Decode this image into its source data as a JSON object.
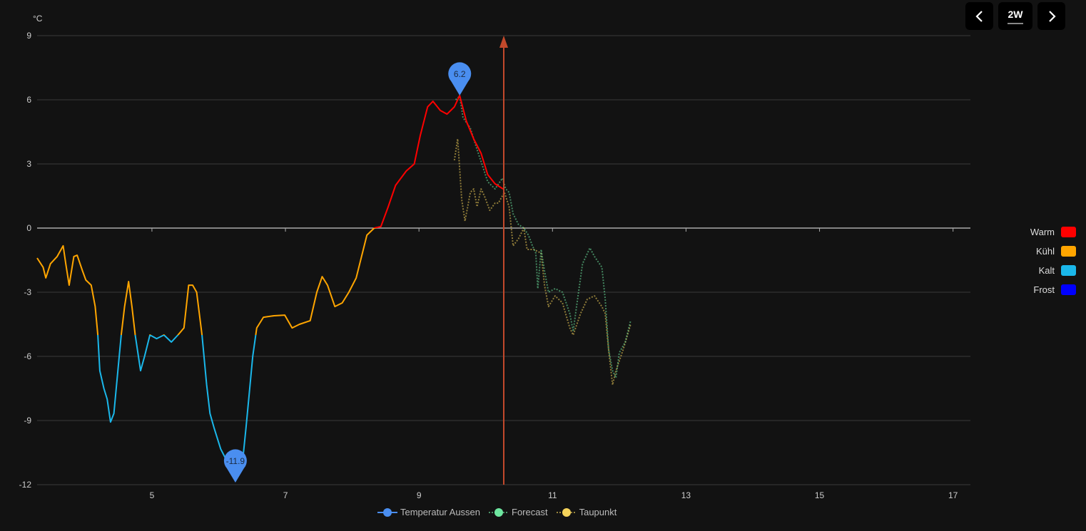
{
  "controls": {
    "range_label": "2W",
    "prev_icon": "chevron-left-icon",
    "next_icon": "chevron-right-icon"
  },
  "colors": {
    "background": "#121212",
    "grid": "#3a3a3a",
    "now_line": "#c2492b",
    "marker": "#4a8ef0"
  },
  "visual_map": [
    {
      "label": "Warm",
      "color": "#ff0000"
    },
    {
      "label": "Kühl",
      "color": "#ffa500"
    },
    {
      "label": "Kalt",
      "color": "#1ab7ea"
    },
    {
      "label": "Frost",
      "color": "#0000ff"
    }
  ],
  "chart_data": {
    "type": "line",
    "ylabel": "°C",
    "ylim": [
      -12,
      9
    ],
    "yticks": [
      9,
      6,
      3,
      0,
      -3,
      -6,
      -9,
      -12
    ],
    "xlim": [
      3.28,
      17.26
    ],
    "xticks": [
      5,
      7,
      9,
      11,
      13,
      15,
      17
    ],
    "grid": true,
    "legend_position": "bottom",
    "now_x": 10.27,
    "series": [
      {
        "name": "Temperatur Aussen",
        "color": "#4a8ef0",
        "style": "solid",
        "x": [
          3.28,
          3.37,
          3.41,
          3.48,
          3.58,
          3.67,
          3.71,
          3.76,
          3.83,
          3.88,
          3.96,
          4.01,
          4.09,
          4.15,
          4.19,
          4.22,
          4.28,
          4.33,
          4.38,
          4.43,
          4.49,
          4.54,
          4.59,
          4.65,
          4.7,
          4.75,
          4.83,
          4.89,
          4.97,
          5.07,
          5.18,
          5.29,
          5.39,
          5.48,
          5.55,
          5.61,
          5.67,
          5.75,
          5.82,
          5.87,
          5.93,
          6.03,
          6.14,
          6.25,
          6.35,
          6.41,
          6.46,
          6.51,
          6.57,
          6.67,
          6.83,
          6.99,
          7.1,
          7.21,
          7.37,
          7.47,
          7.55,
          7.63,
          7.74,
          7.85,
          7.95,
          8.06,
          8.14,
          8.22,
          8.33,
          8.43,
          8.54,
          8.65,
          8.81,
          8.93,
          9.02,
          9.13,
          9.21,
          9.32,
          9.42,
          9.53,
          9.61,
          9.71,
          9.82,
          9.93,
          10.03,
          10.14,
          10.26
        ],
        "y": [
          -1.4,
          -1.83,
          -2.33,
          -1.67,
          -1.33,
          -0.83,
          -1.67,
          -2.67,
          -1.33,
          -1.27,
          -2.0,
          -2.43,
          -2.67,
          -3.67,
          -5.0,
          -6.67,
          -7.5,
          -8.0,
          -9.07,
          -8.67,
          -6.67,
          -5.0,
          -3.67,
          -2.5,
          -3.67,
          -5.0,
          -6.67,
          -6.0,
          -5.0,
          -5.17,
          -5.0,
          -5.33,
          -5.0,
          -4.67,
          -2.67,
          -2.67,
          -3.0,
          -5.0,
          -7.33,
          -8.67,
          -9.33,
          -10.33,
          -11.0,
          -11.83,
          -11.17,
          -9.33,
          -7.67,
          -6.0,
          -4.67,
          -4.17,
          -4.1,
          -4.07,
          -4.67,
          -4.5,
          -4.33,
          -3.0,
          -2.27,
          -2.67,
          -3.67,
          -3.5,
          -3.0,
          -2.33,
          -1.33,
          -0.33,
          0.0,
          0.07,
          1.0,
          2.0,
          2.67,
          3.0,
          4.33,
          5.67,
          5.93,
          5.5,
          5.33,
          5.67,
          6.2,
          5.0,
          4.17,
          3.5,
          2.5,
          2.07,
          1.83
        ]
      },
      {
        "name": "Forecast",
        "color": "#6ee7a0",
        "style": "dotted",
        "x": [
          9.55,
          9.61,
          9.66,
          9.77,
          9.87,
          9.96,
          10.03,
          10.14,
          10.25,
          10.3,
          10.35,
          10.41,
          10.49,
          10.57,
          10.64,
          10.7,
          10.75,
          10.78,
          10.83,
          10.88,
          10.94,
          11.04,
          11.15,
          11.26,
          11.31,
          11.36,
          11.45,
          11.56,
          11.63,
          11.74,
          11.79,
          11.84,
          11.9,
          11.95,
          12.0,
          12.09,
          12.17
        ],
        "y": [
          6.0,
          6.17,
          5.17,
          4.67,
          3.67,
          2.83,
          2.17,
          1.83,
          2.33,
          1.83,
          1.67,
          0.67,
          0.17,
          0.0,
          -0.33,
          -0.83,
          -1.17,
          -2.83,
          -1.0,
          -2.0,
          -3.0,
          -2.83,
          -3.0,
          -4.0,
          -4.83,
          -3.67,
          -1.67,
          -0.93,
          -1.33,
          -1.83,
          -3.33,
          -5.67,
          -6.67,
          -7.0,
          -5.83,
          -5.33,
          -4.33
        ]
      },
      {
        "name": "Taupunkt",
        "color": "#f5d35a",
        "style": "dotted",
        "x": [
          9.53,
          9.58,
          9.64,
          9.69,
          9.77,
          9.82,
          9.87,
          9.93,
          9.98,
          10.06,
          10.14,
          10.19,
          10.28,
          10.35,
          10.41,
          10.49,
          10.57,
          10.62,
          10.72,
          10.83,
          10.88,
          10.94,
          11.04,
          11.15,
          11.26,
          11.31,
          11.42,
          11.52,
          11.63,
          11.74,
          11.79,
          11.84,
          11.9,
          11.95,
          12.06,
          12.17
        ],
        "y": [
          3.17,
          4.17,
          1.33,
          0.33,
          1.67,
          1.83,
          1.0,
          1.83,
          1.5,
          0.83,
          1.17,
          1.17,
          1.67,
          1.0,
          -0.83,
          -0.5,
          0.0,
          -1.0,
          -1.0,
          -1.17,
          -2.67,
          -3.67,
          -3.17,
          -3.5,
          -4.67,
          -5.0,
          -4.0,
          -3.33,
          -3.17,
          -3.67,
          -4.0,
          -5.67,
          -7.33,
          -6.67,
          -5.67,
          -4.5
        ]
      }
    ],
    "mark_points": [
      {
        "label": "6.2",
        "x": 9.61,
        "y": 6.2,
        "type": "max"
      },
      {
        "label": "-11.9",
        "x": 6.25,
        "y": -11.9,
        "type": "min"
      }
    ]
  }
}
